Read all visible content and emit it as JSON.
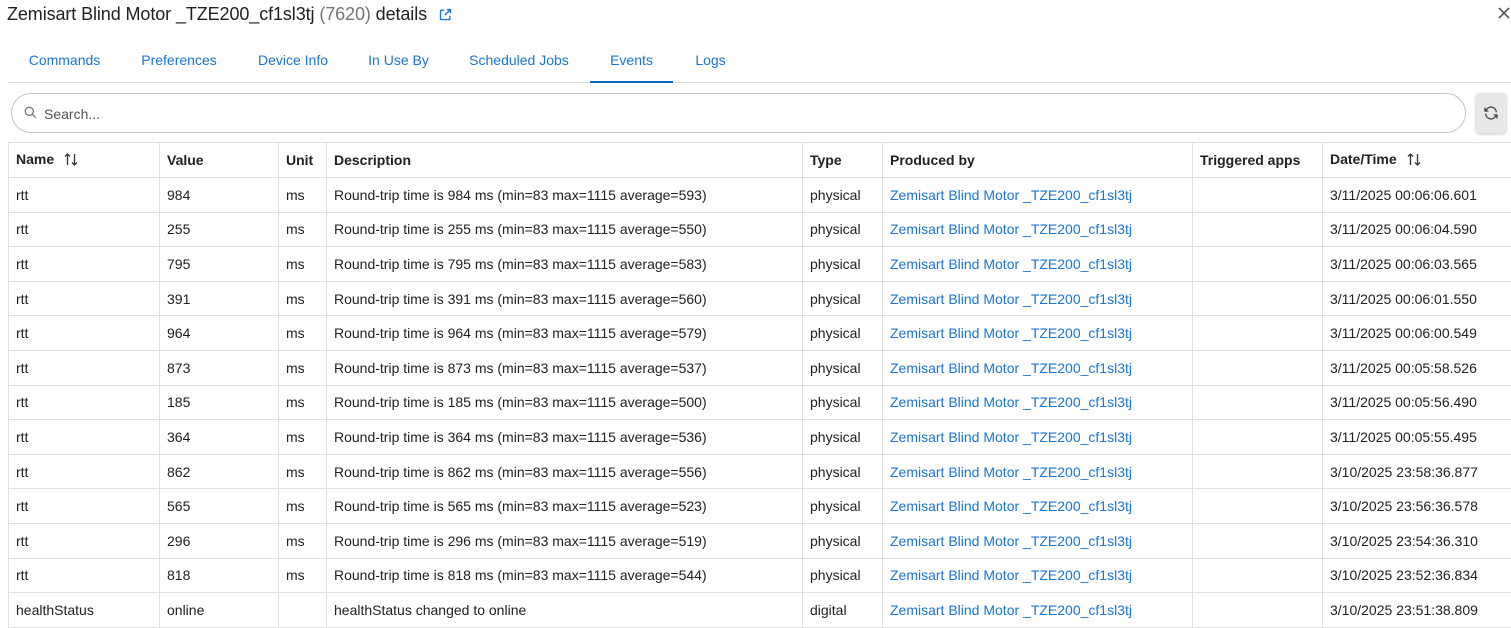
{
  "header": {
    "title": "Zemisart Blind Motor _TZE200_cf1sl3tj",
    "device_id": "(7620)",
    "suffix": "details",
    "external_link_icon": "external-link-icon",
    "close_icon": "close-icon"
  },
  "tabs": [
    {
      "label": "Commands"
    },
    {
      "label": "Preferences"
    },
    {
      "label": "Device Info"
    },
    {
      "label": "In Use By"
    },
    {
      "label": "Scheduled Jobs"
    },
    {
      "label": "Events",
      "active": true
    },
    {
      "label": "Logs"
    }
  ],
  "search": {
    "placeholder": "Search...",
    "value": ""
  },
  "refresh_icon": "refresh-icon",
  "colors": {
    "accent": "#1976d2",
    "border": "#e0e0e0"
  },
  "table": {
    "columns": [
      "Name",
      "Value",
      "Unit",
      "Description",
      "Type",
      "Produced by",
      "Triggered apps",
      "Date/Time"
    ],
    "rows": [
      {
        "name": "rtt",
        "value": "984",
        "unit": "ms",
        "description": "Round-trip time is 984 ms (min=83 max=1115 average=593)",
        "type": "physical",
        "produced_by": "Zemisart Blind Motor _TZE200_cf1sl3tj",
        "triggered_apps": "",
        "datetime": "3/11/2025 00:06:06.601"
      },
      {
        "name": "rtt",
        "value": "255",
        "unit": "ms",
        "description": "Round-trip time is 255 ms (min=83 max=1115 average=550)",
        "type": "physical",
        "produced_by": "Zemisart Blind Motor _TZE200_cf1sl3tj",
        "triggered_apps": "",
        "datetime": "3/11/2025 00:06:04.590"
      },
      {
        "name": "rtt",
        "value": "795",
        "unit": "ms",
        "description": "Round-trip time is 795 ms (min=83 max=1115 average=583)",
        "type": "physical",
        "produced_by": "Zemisart Blind Motor _TZE200_cf1sl3tj",
        "triggered_apps": "",
        "datetime": "3/11/2025 00:06:03.565"
      },
      {
        "name": "rtt",
        "value": "391",
        "unit": "ms",
        "description": "Round-trip time is 391 ms (min=83 max=1115 average=560)",
        "type": "physical",
        "produced_by": "Zemisart Blind Motor _TZE200_cf1sl3tj",
        "triggered_apps": "",
        "datetime": "3/11/2025 00:06:01.550"
      },
      {
        "name": "rtt",
        "value": "964",
        "unit": "ms",
        "description": "Round-trip time is 964 ms (min=83 max=1115 average=579)",
        "type": "physical",
        "produced_by": "Zemisart Blind Motor _TZE200_cf1sl3tj",
        "triggered_apps": "",
        "datetime": "3/11/2025 00:06:00.549"
      },
      {
        "name": "rtt",
        "value": "873",
        "unit": "ms",
        "description": "Round-trip time is 873 ms (min=83 max=1115 average=537)",
        "type": "physical",
        "produced_by": "Zemisart Blind Motor _TZE200_cf1sl3tj",
        "triggered_apps": "",
        "datetime": "3/11/2025 00:05:58.526"
      },
      {
        "name": "rtt",
        "value": "185",
        "unit": "ms",
        "description": "Round-trip time is 185 ms (min=83 max=1115 average=500)",
        "type": "physical",
        "produced_by": "Zemisart Blind Motor _TZE200_cf1sl3tj",
        "triggered_apps": "",
        "datetime": "3/11/2025 00:05:56.490"
      },
      {
        "name": "rtt",
        "value": "364",
        "unit": "ms",
        "description": "Round-trip time is 364 ms (min=83 max=1115 average=536)",
        "type": "physical",
        "produced_by": "Zemisart Blind Motor _TZE200_cf1sl3tj",
        "triggered_apps": "",
        "datetime": "3/11/2025 00:05:55.495"
      },
      {
        "name": "rtt",
        "value": "862",
        "unit": "ms",
        "description": "Round-trip time is 862 ms (min=83 max=1115 average=556)",
        "type": "physical",
        "produced_by": "Zemisart Blind Motor _TZE200_cf1sl3tj",
        "triggered_apps": "",
        "datetime": "3/10/2025 23:58:36.877"
      },
      {
        "name": "rtt",
        "value": "565",
        "unit": "ms",
        "description": "Round-trip time is 565 ms (min=83 max=1115 average=523)",
        "type": "physical",
        "produced_by": "Zemisart Blind Motor _TZE200_cf1sl3tj",
        "triggered_apps": "",
        "datetime": "3/10/2025 23:56:36.578"
      },
      {
        "name": "rtt",
        "value": "296",
        "unit": "ms",
        "description": "Round-trip time is 296 ms (min=83 max=1115 average=519)",
        "type": "physical",
        "produced_by": "Zemisart Blind Motor _TZE200_cf1sl3tj",
        "triggered_apps": "",
        "datetime": "3/10/2025 23:54:36.310"
      },
      {
        "name": "rtt",
        "value": "818",
        "unit": "ms",
        "description": "Round-trip time is 818 ms (min=83 max=1115 average=544)",
        "type": "physical",
        "produced_by": "Zemisart Blind Motor _TZE200_cf1sl3tj",
        "triggered_apps": "",
        "datetime": "3/10/2025 23:52:36.834"
      },
      {
        "name": "healthStatus",
        "value": "online",
        "unit": "",
        "description": "healthStatus changed to online",
        "type": "digital",
        "produced_by": "Zemisart Blind Motor _TZE200_cf1sl3tj",
        "triggered_apps": "",
        "datetime": "3/10/2025 23:51:38.809"
      }
    ]
  }
}
